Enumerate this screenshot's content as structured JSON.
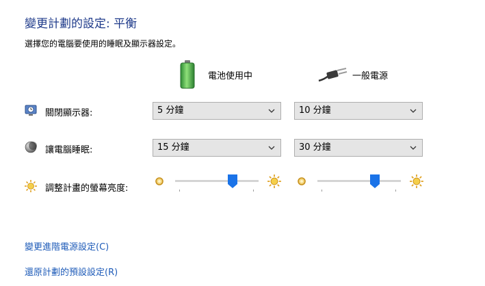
{
  "page": {
    "title": "變更計劃的設定: 平衡",
    "subtitle": "選擇您的電腦要使用的睡眠及顯示器設定。"
  },
  "columns": {
    "battery": {
      "label": "電池使用中",
      "icon": "battery-icon"
    },
    "plugged": {
      "label": "一般電源",
      "icon": "power-plug-icon"
    }
  },
  "settings": {
    "display_off": {
      "label": "關閉顯示器:",
      "icon": "monitor-clock-icon",
      "battery_value": "5 分鐘",
      "plugged_value": "10 分鐘"
    },
    "sleep": {
      "label": "讓電腦睡眠:",
      "icon": "moon-icon",
      "battery_value": "15 分鐘",
      "plugged_value": "30 分鐘"
    },
    "brightness": {
      "label": "調整計畫的螢幕亮度:",
      "icon": "sun-icon",
      "battery_level": 0.71,
      "plugged_level": 0.71
    }
  },
  "links": {
    "advanced": "變更進階電源設定(C)",
    "restore": "還原計劃的預設設定(R)"
  },
  "colors": {
    "title": "#1e3a8a",
    "link": "#1e5bb8",
    "slider_thumb": "#1a73e8",
    "battery_green": "#39b54a"
  }
}
